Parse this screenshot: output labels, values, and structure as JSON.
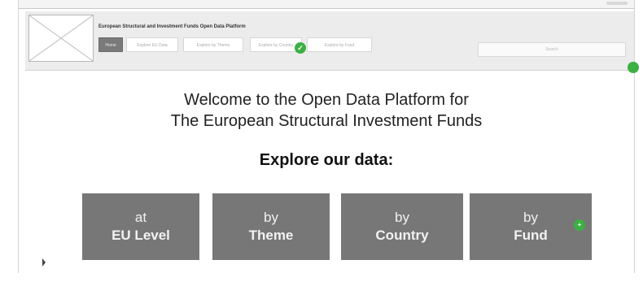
{
  "header": {
    "site_title": "European Structural and Investment Funds Open Data Platform",
    "nav": [
      {
        "label": "Home",
        "active": true
      },
      {
        "label": "Explore EU Data",
        "active": false
      },
      {
        "label": "Explore by Theme",
        "active": false
      },
      {
        "label": "Explore by Country",
        "active": false
      },
      {
        "label": "Explore by Fund",
        "active": false
      }
    ],
    "search_placeholder": "Search"
  },
  "main": {
    "welcome_line1": "Welcome to the Open Data Platform for",
    "welcome_line2": "The European Structural Investment Funds",
    "explore_heading": "Explore our data:",
    "cards": [
      {
        "line1": "at",
        "line2": "EU Level"
      },
      {
        "line1": "by",
        "line2": "Theme"
      },
      {
        "line1": "by",
        "line2": "Country"
      },
      {
        "line1": "by",
        "line2": "Fund"
      }
    ]
  },
  "colors": {
    "card_bg": "#777777",
    "header_bg": "#ececec",
    "active_nav": "#7a7a7a",
    "check": "#3cb043"
  },
  "icons": [
    "logo-placeholder-icon",
    "check-icon",
    "cursor-icon"
  ]
}
